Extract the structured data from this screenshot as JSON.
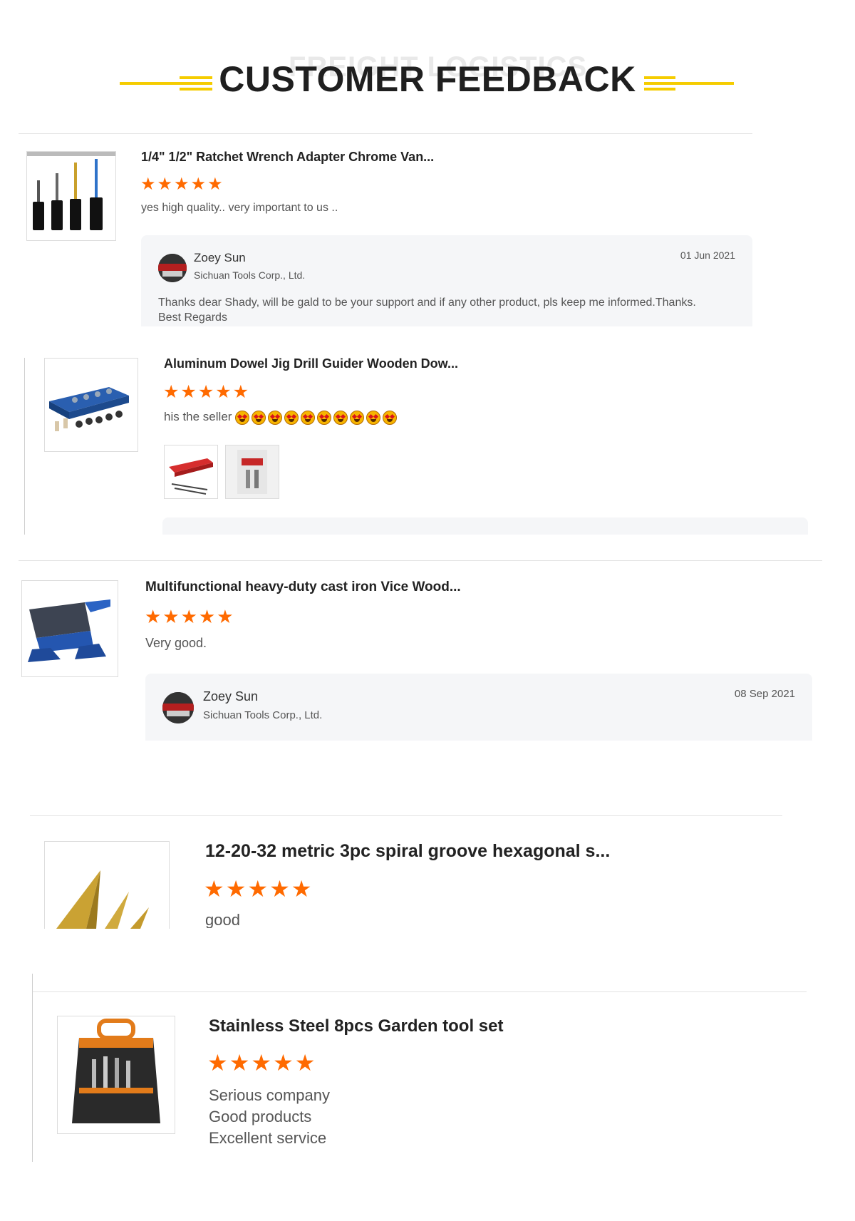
{
  "header": {
    "ghost": "FREIGHT LOGISTICS",
    "title": "CUSTOMER FEEDBACK"
  },
  "colors": {
    "accent": "#f5cc00",
    "star": "#ff6a00"
  },
  "reviews": [
    {
      "title": "1/4\" 1/2\" Ratchet Wrench Adapter Chrome Van...",
      "stars": "★★★★★",
      "rating": 5,
      "text": "yes high quality.. very important to us ..",
      "reply": {
        "name": "Zoey Sun",
        "company": "Sichuan Tools Corp., Ltd.",
        "date": "01 Jun 2021",
        "line1": "Thanks dear Shady, will be gald to be your support and if any other product, pls keep me informed.Thanks.",
        "line2": "Best Regards"
      }
    },
    {
      "title": "Aluminum Dowel Jig Drill Guider Wooden Dow...",
      "stars": "★★★★★",
      "rating": 5,
      "text": "his the seller",
      "emoji_count": 10
    },
    {
      "title": "Multifunctional heavy-duty cast iron Vice Wood...",
      "stars": "★★★★★",
      "rating": 5,
      "text": "Very good.",
      "reply": {
        "name": "Zoey Sun",
        "company": "Sichuan Tools Corp., Ltd.",
        "date": "08 Sep 2021"
      }
    },
    {
      "title": "12-20-32 metric 3pc spiral groove hexagonal s...",
      "stars": "★★★★★",
      "rating": 5,
      "text": "good"
    },
    {
      "title": "Stainless Steel 8pcs Garden tool set",
      "stars": "★★★★★",
      "rating": 5,
      "text_lines": [
        "Serious company",
        "Good products",
        "Excellent service"
      ]
    }
  ]
}
